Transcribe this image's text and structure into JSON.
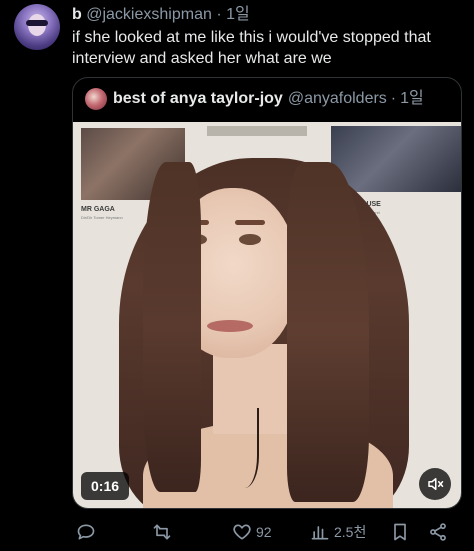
{
  "author": {
    "name": "b",
    "handle": "@jackiexshipman",
    "separator": "·",
    "time": "1일"
  },
  "tweet": {
    "text": "if she looked at me like this i would've stopped that interview and asked her what are we"
  },
  "quote": {
    "name": "best of anya taylor-joy",
    "handle": "@anyafolders",
    "separator": "·",
    "time": "1일",
    "media": {
      "duration": "0:16",
      "wall_labels": [
        {
          "title": "MR GAGA",
          "subtitle": "Dir/Dir Tomer Heymann"
        },
        {
          "title": "IC HOUSE",
          "subtitle": "Dir/Dir Sean Tyrrel"
        }
      ]
    }
  },
  "actions": {
    "like_count": "92",
    "views_count": "2.5천"
  },
  "colors": {
    "background": "#000000",
    "text": "#e7e9ea",
    "muted": "#8b98a5",
    "border": "#2f3336"
  },
  "icons": [
    "reply-icon",
    "retweet-icon",
    "like-icon",
    "views-icon",
    "bookmark-icon",
    "share-icon",
    "mute-icon"
  ]
}
